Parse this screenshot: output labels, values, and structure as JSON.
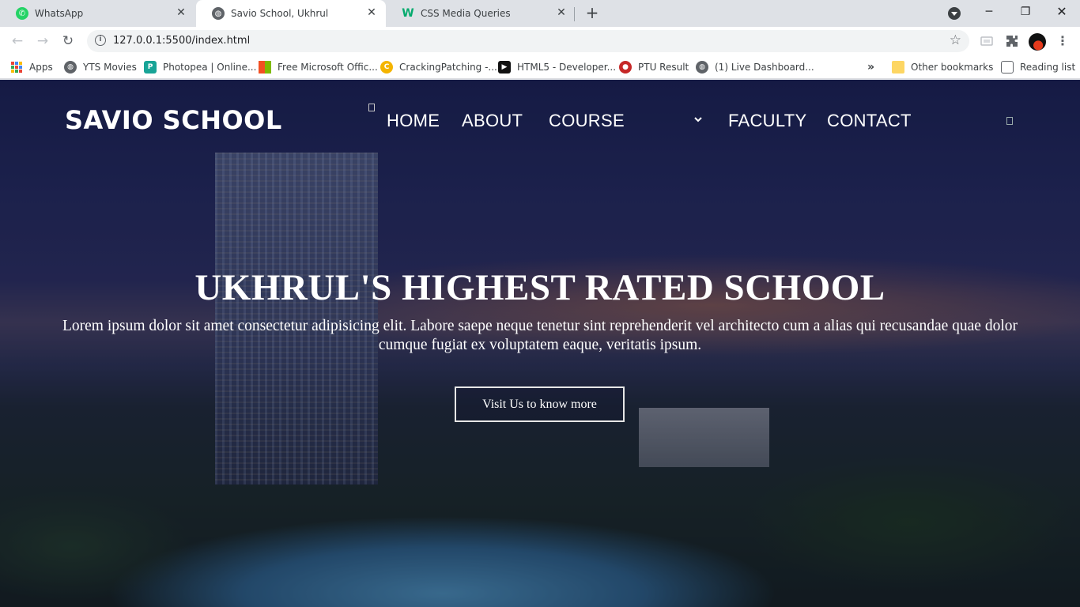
{
  "tabs": [
    {
      "title": "WhatsApp",
      "icon": "whatsapp-icon",
      "active": false
    },
    {
      "title": "Savio School, Ukhrul",
      "icon": "globe-icon",
      "active": true
    },
    {
      "title": "CSS Media Queries",
      "icon": "w3schools-icon",
      "active": false
    }
  ],
  "toolbar": {
    "url": "127.0.0.1:5500/index.html"
  },
  "bookmarks": {
    "items": [
      {
        "label": "Apps",
        "icon": "apps-grid-icon"
      },
      {
        "label": "YTS Movies",
        "icon": "globe-icon"
      },
      {
        "label": "Photopea | Online...",
        "icon": "photopea-icon"
      },
      {
        "label": "Free Microsoft Offic...",
        "icon": "microsoft-icon"
      },
      {
        "label": "CrackingPatching -...",
        "icon": "crackingpatching-icon"
      },
      {
        "label": "HTML5 - Developer...",
        "icon": "html5-icon"
      },
      {
        "label": "PTU Result",
        "icon": "ptu-icon"
      },
      {
        "label": "(1) Live Dashboard...",
        "icon": "globe-icon"
      }
    ],
    "overflow": "»",
    "other": "Other bookmarks",
    "reading_list": "Reading list"
  },
  "site": {
    "logo": "SAVIO SCHOOL",
    "nav": [
      "HOME",
      "ABOUT",
      "COURSE",
      "FACULTY",
      "CONTACT"
    ],
    "headline": "UKHRUL'S HIGHEST RATED SCHOOL",
    "subtext": "Lorem ipsum dolor sit amet consectetur adipisicing elit. Labore saepe neque tenetur sint reprehenderit vel architecto cum a alias qui recusandae quae dolor cumque fugiat ex voluptatem eaque, veritatis ipsum.",
    "cta": "Visit Us to know more"
  },
  "colors": {
    "whatsapp": "#25d366",
    "w3schools": "#04aa6d",
    "hero_dark": "#1a2150"
  }
}
